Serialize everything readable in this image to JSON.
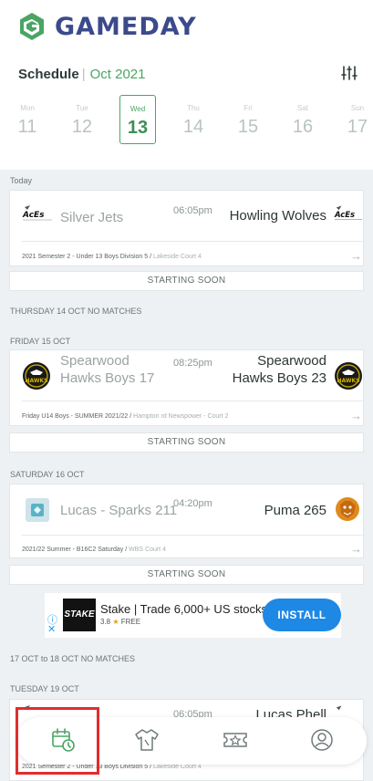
{
  "brand": {
    "name": "GAMEDAY",
    "color": "#3b4a8a",
    "accent": "#4aa563"
  },
  "schedule": {
    "title": "Schedule",
    "separator": "|",
    "month": "Oct 2021"
  },
  "days": [
    {
      "name": "Mon",
      "num": "11",
      "active": false
    },
    {
      "name": "Tue",
      "num": "12",
      "active": false
    },
    {
      "name": "Wed",
      "num": "13",
      "active": true
    },
    {
      "name": "Thu",
      "num": "14",
      "active": false
    },
    {
      "name": "Fri",
      "num": "15",
      "active": false
    },
    {
      "name": "Sat",
      "num": "16",
      "active": false
    },
    {
      "name": "Sun",
      "num": "17",
      "active": false
    }
  ],
  "sections": {
    "today": "Today",
    "thursday": "THURSDAY 14 OCT NO MATCHES",
    "friday": "FRIDAY 15 OCT",
    "saturday": "SATURDAY 16 OCT",
    "oct_17_18": "17 OCT to 18 OCT NO MATCHES",
    "tuesday": "TUESDAY 19 OCT"
  },
  "matches": [
    {
      "home": "Silver Jets",
      "time": "06:05pm",
      "away": "Howling Wolves",
      "competition": "2021 Semester 2 - Under 13 Boys Division 5 / ",
      "venue": "Lakeside Court 4",
      "status": "STARTING SOON"
    },
    {
      "home": "Spearwood Hawks Boys 17",
      "time": "08:25pm",
      "away": "Spearwood Hawks Boys 23",
      "competition": "Friday U14 Boys - SUMMER 2021/22 / ",
      "venue": "Hampton rd Newspower - Court 2",
      "status": "STARTING SOON"
    },
    {
      "home": "Lucas - Sparks 211",
      "time": "04:20pm",
      "away": "Puma 265",
      "competition": "2021/22 Summer - B16C2 Saturday / ",
      "venue": "WBS Court 4",
      "status": "STARTING SOON"
    },
    {
      "home": "",
      "time": "06:05pm",
      "away": "Lucas Phell",
      "competition": "2021 Semester 2 - Under 13 Boys Division 5 / ",
      "venue": "Lakeside Court 4",
      "status": ""
    }
  ],
  "logos": {
    "aces": "AcEs",
    "hawks": "HAWKS"
  },
  "ad": {
    "brand": "STAKE",
    "title": "Stake | Trade 6,000+ US stocks",
    "rating": "3.8",
    "price": "FREE",
    "button": "INSTALL"
  },
  "nav": [
    "calendar-clock-icon",
    "jersey-icon",
    "ticket-star-icon",
    "profile-icon"
  ]
}
